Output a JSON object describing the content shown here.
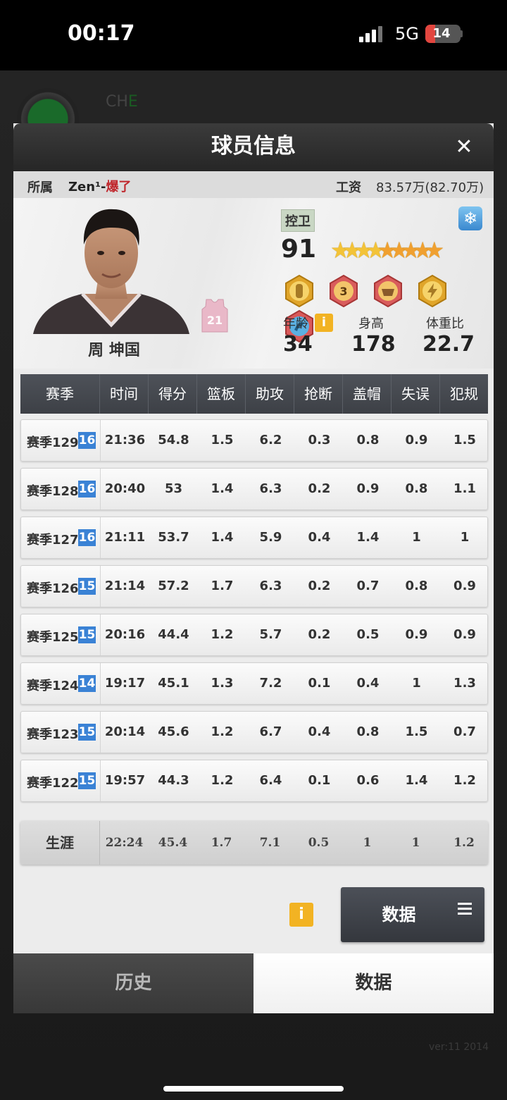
{
  "status_bar": {
    "time": "00:17",
    "network": "5G",
    "battery": "14"
  },
  "background": {
    "label_a": "СН",
    "label_b": "E",
    "version": "ver:11 2014"
  },
  "dialog": {
    "title": "球员信息",
    "close_symbol": "✕",
    "affiliation_label": "所属",
    "team_prefix": "Zen¹-",
    "team_highlight": "爆了",
    "salary_label": "工资",
    "salary_value": "83.57万(82.70万)"
  },
  "player": {
    "name": "周 坤国",
    "jersey_number": "21",
    "position": "控卫",
    "overall": "91",
    "stars": 8.5,
    "age_label": "年龄",
    "age": "34",
    "height_label": "身高",
    "height": "178",
    "bmi_label": "体重比",
    "bmi": "22.7",
    "badges": [
      "defense-badge",
      "three-point-badge",
      "strength-badge",
      "speed-badge",
      "skill-badge"
    ]
  },
  "table": {
    "headers": [
      "赛季",
      "时间",
      "得分",
      "篮板",
      "助攻",
      "抢断",
      "盖帽",
      "失误",
      "犯规"
    ],
    "rows": [
      {
        "season": "赛季129",
        "level": "16",
        "values": [
          "21:36",
          "54.8",
          "1.5",
          "6.2",
          "0.3",
          "0.8",
          "0.9",
          "1.5"
        ]
      },
      {
        "season": "赛季128",
        "level": "16",
        "values": [
          "20:40",
          "53",
          "1.4",
          "6.3",
          "0.2",
          "0.9",
          "0.8",
          "1.1"
        ]
      },
      {
        "season": "赛季127",
        "level": "16",
        "values": [
          "21:11",
          "53.7",
          "1.4",
          "5.9",
          "0.4",
          "1.4",
          "1",
          "1"
        ]
      },
      {
        "season": "赛季126",
        "level": "15",
        "values": [
          "21:14",
          "57.2",
          "1.7",
          "6.3",
          "0.2",
          "0.7",
          "0.8",
          "0.9"
        ]
      },
      {
        "season": "赛季125",
        "level": "15",
        "values": [
          "20:16",
          "44.4",
          "1.2",
          "5.7",
          "0.2",
          "0.5",
          "0.9",
          "0.9"
        ]
      },
      {
        "season": "赛季124",
        "level": "14",
        "values": [
          "19:17",
          "45.1",
          "1.3",
          "7.2",
          "0.1",
          "0.4",
          "1",
          "1.3"
        ]
      },
      {
        "season": "赛季123",
        "level": "15",
        "values": [
          "20:14",
          "45.6",
          "1.2",
          "6.7",
          "0.4",
          "0.8",
          "1.5",
          "0.7"
        ]
      },
      {
        "season": "赛季122",
        "level": "15",
        "values": [
          "19:57",
          "44.3",
          "1.2",
          "6.4",
          "0.1",
          "0.6",
          "1.4",
          "1.2"
        ]
      }
    ],
    "career_label": "生涯",
    "career_values": [
      "22:24",
      "45.4",
      "1.7",
      "7.1",
      "0.5",
      "1",
      "1",
      "1.2"
    ]
  },
  "footer": {
    "info_symbol": "i",
    "data_button_label": "数据"
  },
  "tabs": {
    "history": "历史",
    "data": "数据"
  },
  "colors": {
    "accent_red": "#c0262c",
    "level_blue": "#3a82d5",
    "info_yellow": "#f2b323"
  }
}
